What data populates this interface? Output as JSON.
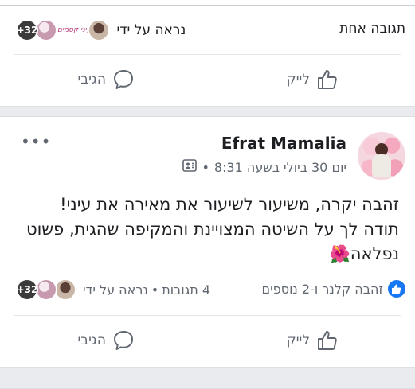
{
  "previous_post": {
    "reply_count_label": "תגובה אחת",
    "seen_by_label": "נראה על ידי",
    "seen_count": "+32",
    "seen_logo_text": "עיני קסמים",
    "like_label": "לייק",
    "comment_label": "הגיבי"
  },
  "post": {
    "author": "Efrat Mamalia",
    "date": "יום 30 ביולי בשעה 8:31",
    "meta_separator": "•",
    "more_label": "•••",
    "text": "זהבה יקרה, משיעור לשיעור את מאירה את עיני! תודה לך על השיטה המצויינת והמקיפה שהגית, פשוט נפלאה🌺",
    "reactions_label": "זהבה קלנר ו-2 נוספים",
    "comments_label": "4 תגובות",
    "seen_by_label": "נראה על ידי",
    "seen_separator": "•",
    "seen_count": "+32",
    "like_label": "לייק",
    "comment_label": "הגיבי"
  },
  "colors": {
    "facebook_blue": "#1877f2",
    "separator_gray": "#e9ebee",
    "meta_gray": "#606770"
  }
}
